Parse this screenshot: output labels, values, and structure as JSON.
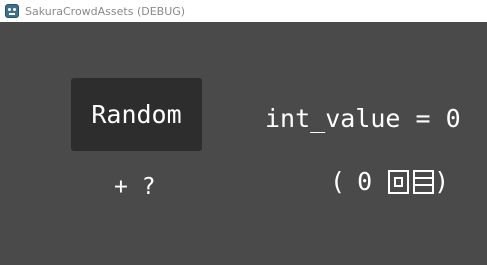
{
  "window": {
    "title": "SakuraCrowdAssets (DEBUG)"
  },
  "main": {
    "random_button_label": "Random",
    "plus_label": "+ ?",
    "int_value_label": "int_value = 0",
    "paren_open": "(",
    "paren_value": "0",
    "paren_close": ")"
  },
  "colors": {
    "background": "#4a4a4a",
    "button_background": "#2d2d2d",
    "text": "#ffffff",
    "titlebar": "#ffffff",
    "title_text": "#8a8a8a"
  },
  "icons": {
    "app": "godot-app-icon",
    "glyph_1": "square-in-box-glyph",
    "glyph_2": "lines-in-box-glyph"
  }
}
